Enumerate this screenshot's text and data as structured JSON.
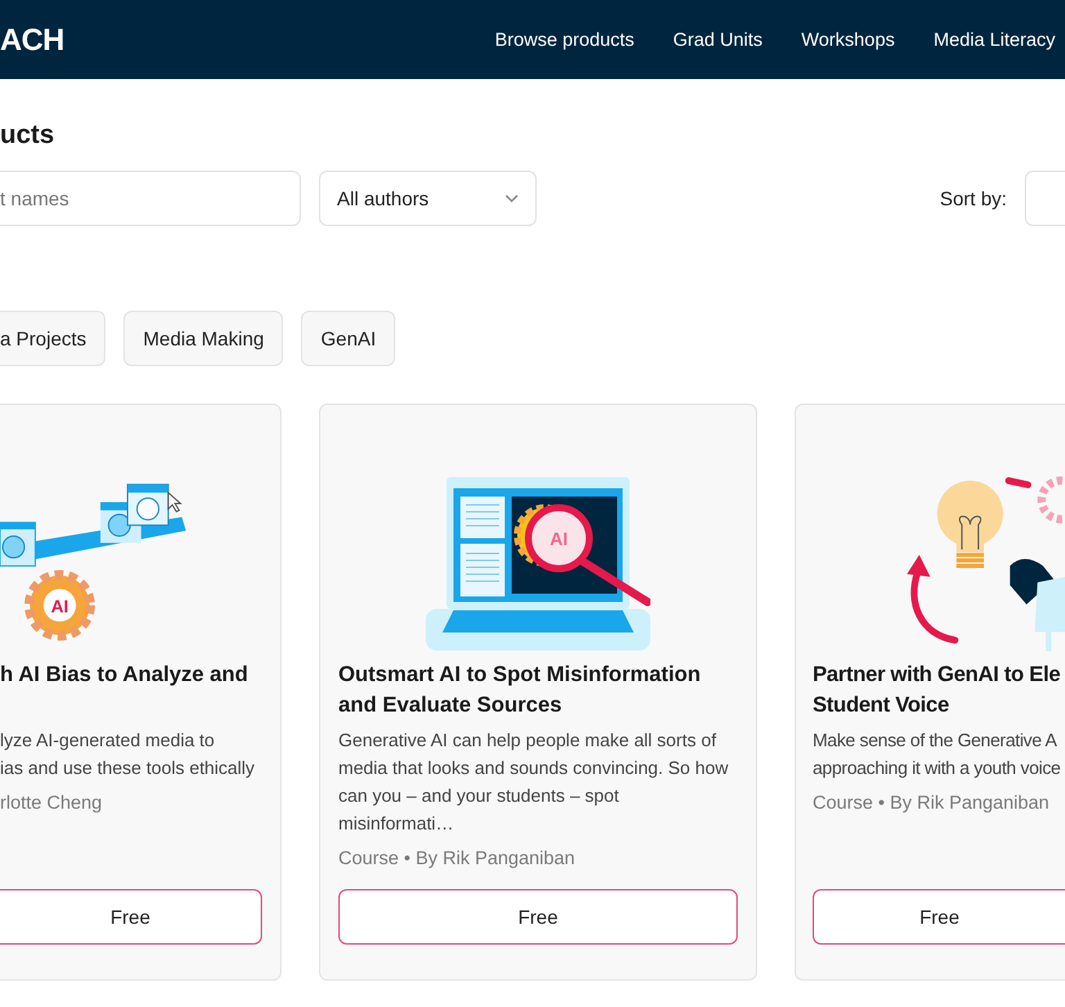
{
  "header": {
    "logo": "ACH",
    "nav": [
      {
        "label": "Browse products"
      },
      {
        "label": "Grad Units"
      },
      {
        "label": "Workshops"
      },
      {
        "label": "Media Literacy"
      }
    ]
  },
  "page_title": "ucts",
  "filters": {
    "search": {
      "placeholder": "t names"
    },
    "author": {
      "value": "All authors"
    },
    "sort_label": "Sort by:"
  },
  "tags": [
    {
      "label": "a Projects"
    },
    {
      "label": "Media Making"
    },
    {
      "label": "GenAI"
    }
  ],
  "cards": [
    {
      "illustration": {
        "kind": "seesaw",
        "label": "AI"
      },
      "title": "h AI Bias to Analyze and",
      "description": "lyze AI-generated media to\nias and use these tools ethically",
      "meta": "rlotte Cheng",
      "price": "Free"
    },
    {
      "illustration": {
        "kind": "laptop",
        "label": "AI"
      },
      "title": "Outsmart AI to Spot Misinformation and Evaluate Sources",
      "description": "Generative AI can help people make all sorts of media that looks and sounds convincing. So how can you – and your students – spot misinformati…",
      "meta": "Course • By Rik Panganiban",
      "price": "Free"
    },
    {
      "illustration": {
        "kind": "bulb"
      },
      "title": "Partner with GenAI to Ele\nStudent Voice",
      "description": "Make sense of the Generative A\napproaching it with a youth voice",
      "meta": "Course • By Rik Panganiban",
      "price": "Free"
    }
  ]
}
